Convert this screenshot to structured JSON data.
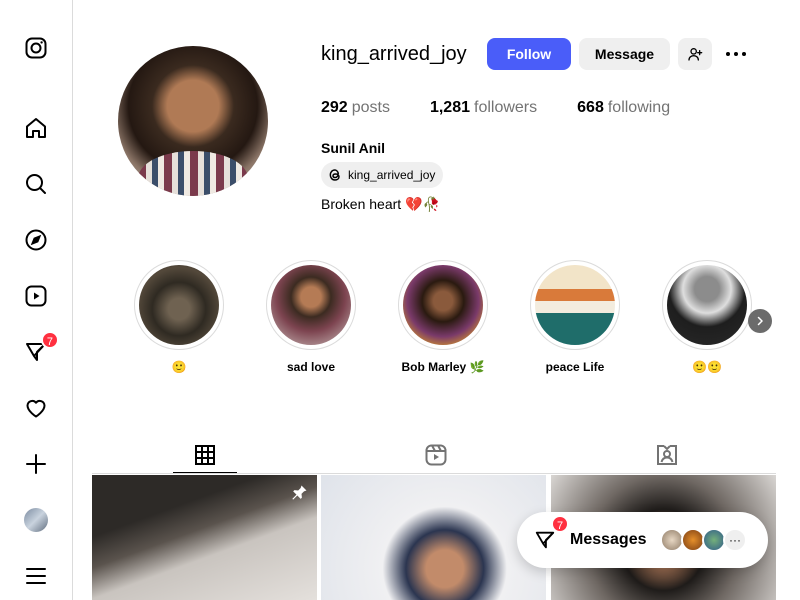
{
  "sidebar": {
    "notifications_badge": "7",
    "items": [
      {
        "name": "instagram-logo-icon"
      },
      {
        "name": "home-icon"
      },
      {
        "name": "search-icon"
      },
      {
        "name": "explore-icon"
      },
      {
        "name": "reels-icon"
      },
      {
        "name": "messenger-icon"
      },
      {
        "name": "heart-icon"
      },
      {
        "name": "create-icon"
      },
      {
        "name": "profile-avatar"
      },
      {
        "name": "menu-icon"
      }
    ]
  },
  "profile": {
    "username": "king_arrived_joy",
    "follow_label": "Follow",
    "message_label": "Message",
    "stats": {
      "posts_count": "292",
      "posts_label": "posts",
      "followers_count": "1,281",
      "followers_label": "followers",
      "following_count": "668",
      "following_label": "following"
    },
    "full_name": "Sunil Anil",
    "threads_handle": "king_arrived_joy",
    "bio": "Broken heart 💔🥀"
  },
  "highlights": [
    {
      "label": "🙂"
    },
    {
      "label": "sad love"
    },
    {
      "label": "Bob Marley 🌿"
    },
    {
      "label": "peace Life"
    },
    {
      "label": "🙂🙂"
    }
  ],
  "tabs": [
    {
      "name": "posts-tab",
      "icon": "grid-icon",
      "active": true
    },
    {
      "name": "reels-tab",
      "icon": "reels-icon",
      "active": false
    },
    {
      "name": "tagged-tab",
      "icon": "tagged-icon",
      "active": false
    }
  ],
  "messages_float": {
    "label": "Messages",
    "badge": "7",
    "more": "···"
  },
  "colors": {
    "accent": "#4a5df9",
    "badge": "#ff3040",
    "border": "#dbdbdb",
    "muted": "#737373"
  }
}
